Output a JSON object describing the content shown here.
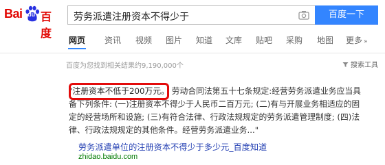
{
  "logo": {
    "bai": "Bai",
    "du": "du",
    "cn": "百度"
  },
  "search": {
    "query": "劳务派遣注册资本不得少于",
    "button": "百度一下"
  },
  "tabs": [
    {
      "label": "网页"
    },
    {
      "label": "资讯"
    },
    {
      "label": "视频"
    },
    {
      "label": "图片"
    },
    {
      "label": "知道"
    },
    {
      "label": "文库"
    },
    {
      "label": "贴吧"
    },
    {
      "label": "采购"
    },
    {
      "label": "地图"
    },
    {
      "label": "更多"
    }
  ],
  "more_arrow": "»",
  "result_count": "百度为您找到相关结果约9,190,000个",
  "search_tools": "搜索工具",
  "result": {
    "highlight": "\"注册资本不低于200万元。",
    "snippet_rest": " 劳动合同法第五十七条规定:经营劳务派遣业务应当具备下列条件: (一)注册资本不得少于人民币二百万元; (二)有与开展业务相适应的固定的经营场所和设施; (三)有符合法律、行政法规规定的劳务派遣管理制度; (四)法律、行政法规规定的其他条件。经营劳务派遣业务...\"",
    "title": "劳务派遣单位的注册资本不得少于多少元_百度知道",
    "url": "zhidao.baidu.com"
  },
  "colors": {
    "brand_red": "#e10602",
    "button_blue": "#3385ff",
    "link_blue": "#2440b3",
    "url_green": "#007a00",
    "annotation_red": "#e30b0b"
  }
}
